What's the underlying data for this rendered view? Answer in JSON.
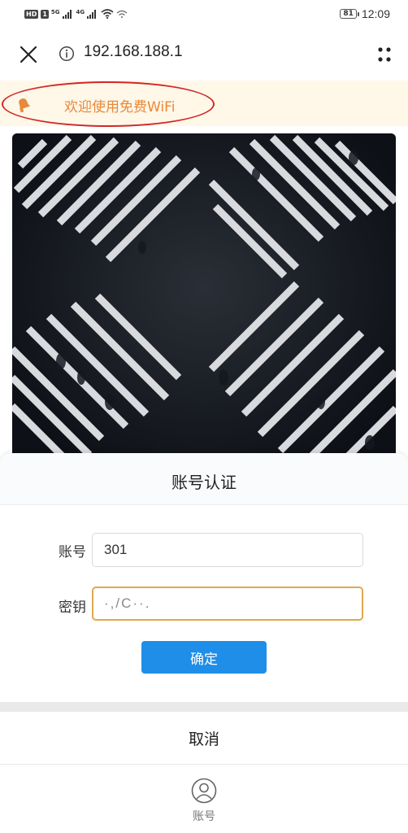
{
  "status_bar": {
    "sim_badge_1": "HD",
    "sim_slot_1": "1",
    "net_1": "5G",
    "net_2": "4G",
    "battery": "81",
    "time": "12:09"
  },
  "browser": {
    "url": "192.168.188.1",
    "close_icon": "close-icon",
    "info_icon": "info-icon",
    "more_icon": "more-dots-icon"
  },
  "notice": {
    "text": "欢迎使用免费WiFi",
    "icon": "bell-icon",
    "accent": "#e8893a",
    "annotation_color": "#d02828"
  },
  "sheet": {
    "title": "账号认证",
    "account_label": "账号",
    "account_value": "301",
    "password_label": "密钥",
    "password_value": "·,/C··.",
    "confirm_label": "确定",
    "cancel_label": "取消",
    "confirm_color": "#1e8ee8"
  },
  "tab_bar": {
    "account_label": "账号",
    "account_icon": "user-circle-icon"
  }
}
